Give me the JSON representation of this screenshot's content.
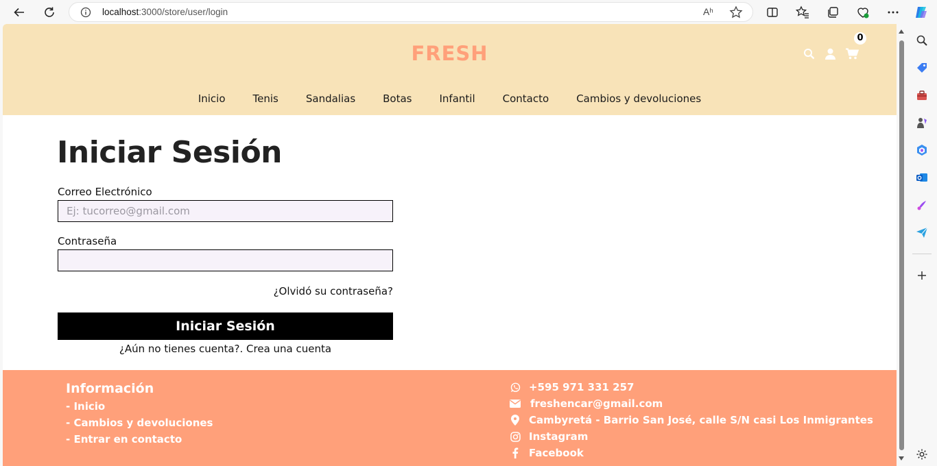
{
  "browser": {
    "url_host": "localhost",
    "url_path": ":3000/store/user/login",
    "read_aloud_label": "Aʰ"
  },
  "site": {
    "logo": "FRESH",
    "cart_count": "0",
    "menu": [
      "Inicio",
      "Tenis",
      "Sandalias",
      "Botas",
      "Infantil",
      "Contacto",
      "Cambios y devoluciones"
    ]
  },
  "login": {
    "title": "Iniciar Sesión",
    "email_label": "Correo Electrónico",
    "email_placeholder": "Ej: tucorreo@gmail.com",
    "password_label": "Contraseña",
    "forgot": "¿Olvidó su contraseña?",
    "submit": "Iniciar Sesión",
    "signup": "¿Aún no tienes cuenta?. Crea una cuenta"
  },
  "footer": {
    "title": "Información",
    "links": [
      "- Inicio",
      "- Cambios y devoluciones",
      "- Entrar en contacto"
    ],
    "phone": "+595 971 331 257",
    "email": "freshencar@gmail.com",
    "address": "Cambyretá - Barrio San José, calle S/N casi Los Inmigrantes",
    "instagram": "Instagram",
    "facebook": "Facebook"
  },
  "colors": {
    "header_bg": "#f8e3b8",
    "brand": "#ffa07a",
    "footer_bg": "#ffa07a"
  }
}
